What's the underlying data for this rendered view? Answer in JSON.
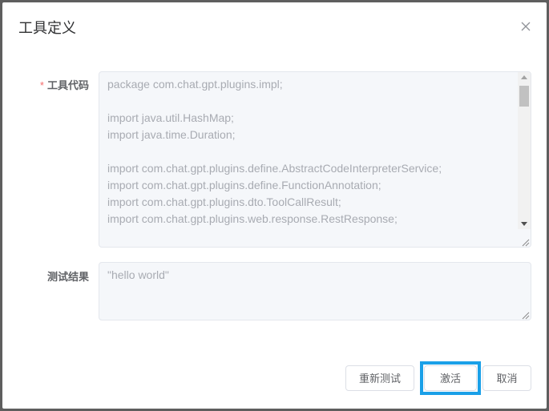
{
  "dialog": {
    "title": "工具定义",
    "close_icon": "close-icon"
  },
  "form": {
    "code_field": {
      "required_mark": "*",
      "label": "工具代码",
      "lines": [
        "package com.chat.gpt.plugins.impl;",
        "",
        "import java.util.HashMap;",
        "import java.time.Duration;",
        "",
        "import com.chat.gpt.plugins.define.AbstractCodeInterpreterService;",
        "import com.chat.gpt.plugins.define.FunctionAnnotation;",
        "import com.chat.gpt.plugins.dto.ToolCallResult;",
        "import com.chat.gpt.plugins.web.response.RestResponse;"
      ]
    },
    "result_field": {
      "label": "测试结果",
      "value": "\"hello world\""
    }
  },
  "footer": {
    "retest_label": "重新测试",
    "activate_label": "激活",
    "cancel_label": "取消"
  },
  "colors": {
    "required": "#f56c6c",
    "highlight": "#1aa0e8",
    "placeholder_text": "#a8abb2"
  }
}
